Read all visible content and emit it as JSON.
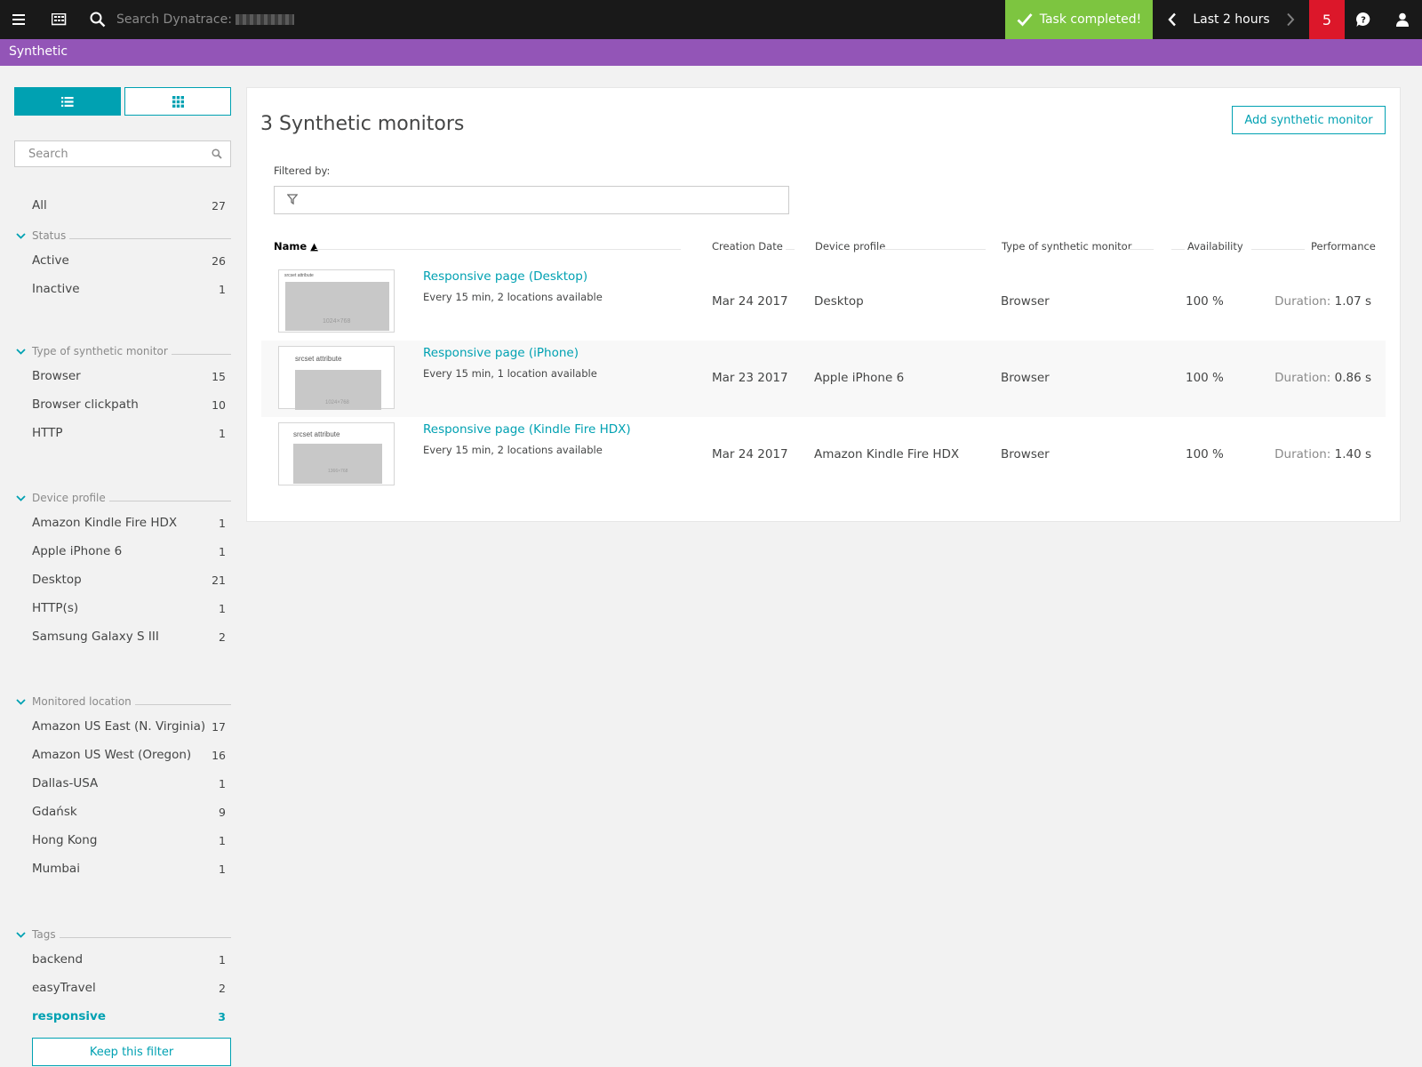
{
  "topbar": {
    "search_placeholder": "Search Dynatrace:",
    "task_status": "Task completed!",
    "timeframe": "Last 2 hours",
    "problems_count": "5",
    "icons": [
      "menu-icon",
      "dashboard-icon",
      "search-icon",
      "check-icon",
      "chevron-left-icon",
      "chevron-right-icon",
      "help-icon",
      "user-icon"
    ]
  },
  "appbar": {
    "title": "Synthetic"
  },
  "sidebar": {
    "search_placeholder": "Search",
    "all": {
      "label": "All",
      "count": "27"
    },
    "status": {
      "title": "Status",
      "items": [
        {
          "label": "Active",
          "count": "26"
        },
        {
          "label": "Inactive",
          "count": "1"
        }
      ]
    },
    "type": {
      "title": "Type of synthetic monitor",
      "items": [
        {
          "label": "Browser",
          "count": "15"
        },
        {
          "label": "Browser clickpath",
          "count": "10"
        },
        {
          "label": "HTTP",
          "count": "1"
        }
      ]
    },
    "device": {
      "title": "Device profile",
      "items": [
        {
          "label": "Amazon Kindle Fire HDX",
          "count": "1"
        },
        {
          "label": "Apple iPhone 6",
          "count": "1"
        },
        {
          "label": "Desktop",
          "count": "21"
        },
        {
          "label": "HTTP(s)",
          "count": "1"
        },
        {
          "label": "Samsung Galaxy S III",
          "count": "2"
        }
      ]
    },
    "location": {
      "title": "Monitored location",
      "items": [
        {
          "label": "Amazon US East (N. Virginia)",
          "count": "17"
        },
        {
          "label": "Amazon US West (Oregon)",
          "count": "16"
        },
        {
          "label": "Dallas-USA",
          "count": "1"
        },
        {
          "label": "Gdańsk",
          "count": "9"
        },
        {
          "label": "Hong Kong",
          "count": "1"
        },
        {
          "label": "Mumbai",
          "count": "1"
        }
      ]
    },
    "tags": {
      "title": "Tags",
      "items": [
        {
          "label": "backend",
          "count": "1"
        },
        {
          "label": "easyTravel",
          "count": "2"
        },
        {
          "label": "responsive",
          "count": "3"
        }
      ]
    },
    "keep_filter_label": "Keep this filter"
  },
  "main": {
    "title": "3 Synthetic monitors",
    "add_button": "Add synthetic monitor",
    "filtered_by": "Filtered by:",
    "columns": {
      "name": "Name ▲",
      "creation_date": "Creation Date",
      "device_profile": "Device profile",
      "type": "Type of synthetic monitor",
      "availability": "Availability",
      "performance": "Performance"
    },
    "rows": [
      {
        "name": "Responsive page (Desktop)",
        "schedule": "Every 15 min, 2 locations available",
        "created": "Mar 24 2017",
        "device": "Desktop",
        "type": "Browser",
        "availability": "100 %",
        "perf_label": "Duration:",
        "perf_value": "1.07 s",
        "thumb_caption": "srcset attribute",
        "thumb_dims": "1024×768"
      },
      {
        "name": "Responsive page (iPhone)",
        "schedule": "Every 15 min, 1 location available",
        "created": "Mar 23 2017",
        "device": "Apple iPhone 6",
        "type": "Browser",
        "availability": "100 %",
        "perf_label": "Duration:",
        "perf_value": "0.86 s",
        "thumb_caption": "srcset attribute",
        "thumb_dims": "1024×768"
      },
      {
        "name": "Responsive page (Kindle Fire HDX)",
        "schedule": "Every 15 min, 2 locations available",
        "created": "Mar 24 2017",
        "device": "Amazon Kindle Fire HDX",
        "type": "Browser",
        "availability": "100 %",
        "perf_label": "Duration:",
        "perf_value": "1.40 s",
        "thumb_caption": "srcset attribute",
        "thumb_dims": "1366×768"
      }
    ]
  },
  "colors": {
    "accent": "#00a1b2",
    "appbar": "#9355b7",
    "success": "#7dc540",
    "problems": "#dc172a",
    "topbar": "#191919"
  }
}
